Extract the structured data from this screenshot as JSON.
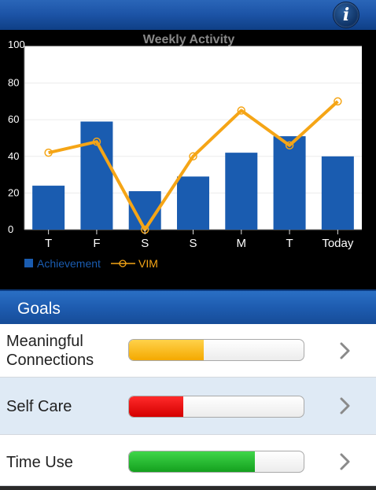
{
  "app": {
    "info_icon": "info-icon",
    "info_glyph": "i"
  },
  "chart_data": {
    "type": "bar",
    "title": "Weekly Activity",
    "categories": [
      "T",
      "F",
      "S",
      "S",
      "M",
      "T",
      "Today"
    ],
    "series": [
      {
        "name": "Achievement",
        "kind": "bar",
        "color": "#1a5cb0",
        "values": [
          24,
          59,
          21,
          29,
          42,
          51,
          40
        ]
      },
      {
        "name": "VIM",
        "kind": "line",
        "color": "#f5a516",
        "values": [
          42,
          48,
          0,
          40,
          65,
          46,
          70
        ]
      }
    ],
    "y_ticks": [
      "0",
      "20",
      "40",
      "60",
      "80",
      "100"
    ],
    "ylim": [
      0,
      100
    ],
    "grid": true,
    "legend_position": "bottom-left"
  },
  "goals": {
    "title": "Goals",
    "items": [
      {
        "label": "Meaningful\nConnections",
        "value_fraction": 0.43,
        "color_top": "#ffd24a",
        "color_bottom": "#f4a900",
        "chevron": "chevron-right-icon"
      },
      {
        "label": "Self Care",
        "value_fraction": 0.31,
        "color_top": "#ff2a2a",
        "color_bottom": "#d40000",
        "chevron": "chevron-right-icon"
      },
      {
        "label": "Time Use",
        "value_fraction": 0.72,
        "color_top": "#3fd64a",
        "color_bottom": "#14a01e",
        "chevron": "chevron-right-icon"
      }
    ]
  }
}
